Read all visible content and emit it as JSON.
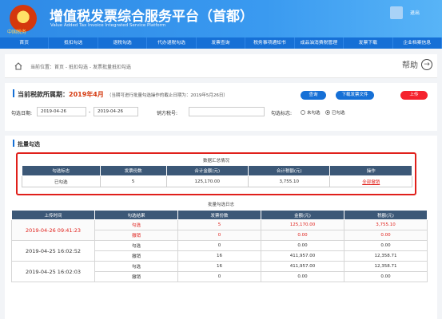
{
  "header": {
    "logo_text": "中国税务",
    "title": "增值税发票综合服务平台",
    "title_suffix": "（首都）",
    "subtitle": "Value Added Tax Invoice Integrated Service Platform",
    "logout": "退出"
  },
  "nav": [
    "首页",
    "抵扣勾选",
    "退税勾选",
    "代办退税勾选",
    "发票查询",
    "税务事项通知书",
    "成品油消费税管理",
    "发票下载",
    "企业档案信息"
  ],
  "breadcrumb": {
    "text": "当前位置：首页 - 抵扣勾选 - 发票批量抵扣勾选",
    "help": "帮助"
  },
  "period": {
    "label": "当前税款所属期：",
    "value": "2019年4月",
    "note": "（当期可进行批量勾选操作的截止日期为：2019年5月26日）"
  },
  "buttons": {
    "query": "查询",
    "download": "下载发票文件",
    "upload": "上传"
  },
  "filter": {
    "date_label": "勾选日期:",
    "date_from": "2019-04-26",
    "date_sep": "-",
    "date_to": "2019-04-26",
    "seller_label": "销方税号:",
    "seller_value": "",
    "status_label": "勾选标志:",
    "option_unselected": "未勾选",
    "option_selected": "已勾选",
    "selected_option": "已勾选"
  },
  "section_title": "批量勾选",
  "summary": {
    "caption": "数据汇总情况",
    "headers": [
      "勾选标志",
      "发票份数",
      "合计金额(元)",
      "合计税额(元)",
      "操作"
    ],
    "row": {
      "status": "已勾选",
      "count": "5",
      "amount": "125,170.00",
      "tax": "3,755.10",
      "action": "全部撤销"
    }
  },
  "detail": {
    "caption": "批量勾选日志",
    "headers": [
      "上传时间",
      "勾选结果",
      "发票份数",
      "金额(元)",
      "税额(元)"
    ],
    "groups": [
      {
        "time": "2019-04-26 09:41:23",
        "rows": [
          {
            "result": "勾选",
            "count": "5",
            "amount": "125,170.00",
            "tax": "3,755.10"
          },
          {
            "result": "撤销",
            "count": "0",
            "amount": "0.00",
            "tax": "0.00"
          }
        ]
      },
      {
        "time": "2019-04-25 16:02:52",
        "rows": [
          {
            "result": "勾选",
            "count": "0",
            "amount": "0.00",
            "tax": "0.00"
          },
          {
            "result": "撤销",
            "count": "16",
            "amount": "411,957.00",
            "tax": "12,358.71"
          }
        ]
      },
      {
        "time": "2019-04-25 16:02:03",
        "rows": [
          {
            "result": "勾选",
            "count": "16",
            "amount": "411,957.00",
            "tax": "12,358.71"
          },
          {
            "result": "撤销",
            "count": "0",
            "amount": "0.00",
            "tax": "0.00"
          }
        ]
      }
    ]
  },
  "colors": {
    "header_blue": "#2e8ae6",
    "nav_blue": "#1670d6",
    "table_header": "#3c5877",
    "accent_red": "#e0201b"
  }
}
